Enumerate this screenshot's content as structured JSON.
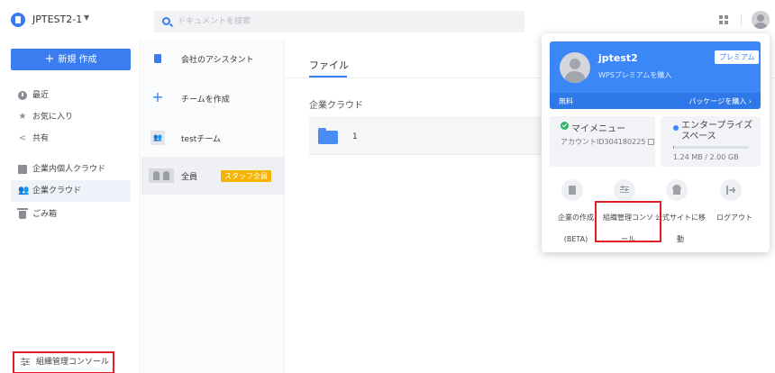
{
  "colors": {
    "accent": "#3b7cf0",
    "highlight": "#e01e25",
    "badge": "#f5b400",
    "success": "#2fb56a"
  },
  "topbar": {
    "workspace_name": "JPTEST2-1",
    "workspace_caret": "▼",
    "search_placeholder": "ドキュメントを検索",
    "icons": [
      "workspace-logo-icon",
      "search-icon",
      "apps-grid-icon",
      "user-avatar"
    ]
  },
  "sidebar": {
    "new_button": "新規 作成",
    "new_plus": "+",
    "items": [
      {
        "label": "最近",
        "icon": "clock-icon"
      },
      {
        "label": "お気に入り",
        "icon": "star-icon"
      },
      {
        "label": "共有",
        "icon": "share-icon"
      },
      {
        "label": "企業内個人クラウド",
        "icon": "document-icon"
      },
      {
        "label": "企業クラウド",
        "icon": "people-icon",
        "active": true
      },
      {
        "label": "ごみ箱",
        "icon": "trash-icon"
      }
    ],
    "console_link": "組織管理コンソール"
  },
  "teams": {
    "items": [
      {
        "label": "会社のアシスタント",
        "icon": "building-icon"
      },
      {
        "label": "チームを作成",
        "icon": "plus-icon"
      },
      {
        "label": "testチーム",
        "icon": "team-icon"
      },
      {
        "label": "全員",
        "icon": "all-members-icon",
        "badge": "スタッフ全員",
        "active": true
      }
    ]
  },
  "main": {
    "tab": "ファイル",
    "section_title": "企業クラウド",
    "files": [
      {
        "name": "1",
        "icon": "folder-icon",
        "trailing": "("
      }
    ]
  },
  "popover": {
    "username": "jptest2",
    "upgrade_text": "WPSプレミアムを購入",
    "premium_button": "プレミアム",
    "plan": "無料",
    "buy_package": "パッケージを購入 ›",
    "my_menu": "マイメニュー",
    "account_id": "アカウントID304180225",
    "storage_title": "エンタープライズスペース",
    "storage_usage": "1.24 MB / 2.00 GB",
    "storage_used_fraction": 0.0006,
    "actions": [
      {
        "line1": "企業の作成",
        "line2": "(BETA)",
        "icon": "building-icon"
      },
      {
        "line1": "組織管理コンソ",
        "line2": "ール",
        "icon": "sliders-icon"
      },
      {
        "line1": "公式サイトに移",
        "line2": "動",
        "icon": "home-icon"
      },
      {
        "line1": "ログアウト",
        "line2": "",
        "icon": "logout-icon"
      }
    ]
  }
}
